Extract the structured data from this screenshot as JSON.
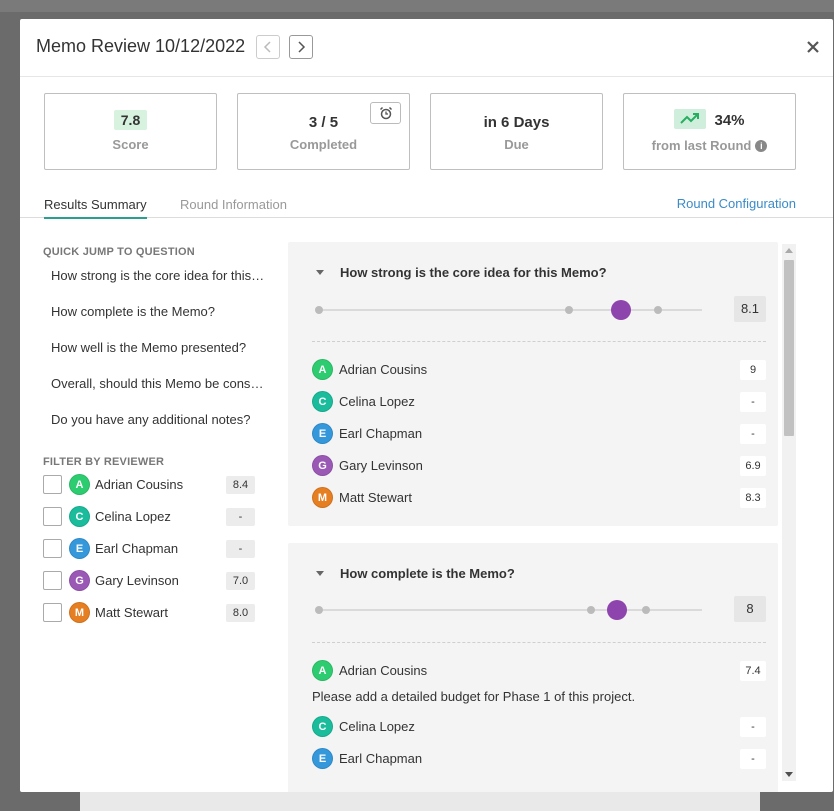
{
  "modal": {
    "title": "Memo Review 10/12/2022"
  },
  "stats": [
    {
      "value": "7.8",
      "label": "Score"
    },
    {
      "value": "3 / 5",
      "label": "Completed"
    },
    {
      "value": "in 6 Days",
      "label": "Due"
    },
    {
      "value": "34%",
      "label": "from last Round"
    }
  ],
  "tabs": {
    "results": "Results Summary",
    "round_info": "Round Information",
    "config": "Round Configuration"
  },
  "sidebar": {
    "jump_title": "QUICK JUMP TO QUESTION",
    "jump_items": [
      "How strong is the core idea for this Memo?",
      "How complete is the Memo?",
      "How well is the Memo presented?",
      "Overall, should this Memo be considered?",
      "Do you have any additional notes?"
    ],
    "filter_title": "FILTER BY REVIEWER",
    "reviewers": [
      {
        "initial": "A",
        "name": "Adrian Cousins",
        "score": "8.4"
      },
      {
        "initial": "C",
        "name": "Celina Lopez",
        "score": "-"
      },
      {
        "initial": "E",
        "name": "Earl Chapman",
        "score": "-"
      },
      {
        "initial": "G",
        "name": "Gary Levinson",
        "score": "7.0"
      },
      {
        "initial": "M",
        "name": "Matt Stewart",
        "score": "8.0"
      }
    ]
  },
  "questions": [
    {
      "text": "How strong is the core idea for this Memo?",
      "average": "8.1",
      "slider_value": 0.81,
      "responses": [
        {
          "initial": "A",
          "name": "Adrian Cousins",
          "score": "9"
        },
        {
          "initial": "C",
          "name": "Celina Lopez",
          "score": "-"
        },
        {
          "initial": "E",
          "name": "Earl Chapman",
          "score": "-"
        },
        {
          "initial": "G",
          "name": "Gary Levinson",
          "score": "6.9"
        },
        {
          "initial": "M",
          "name": "Matt Stewart",
          "score": "8.3"
        }
      ]
    },
    {
      "text": "How complete is the Memo?",
      "average": "8",
      "slider_value": 0.8,
      "responses": [
        {
          "initial": "A",
          "name": "Adrian Cousins",
          "score": "7.4",
          "note": "Please add a detailed budget for Phase 1 of this project."
        },
        {
          "initial": "C",
          "name": "Celina Lopez",
          "score": "-"
        },
        {
          "initial": "E",
          "name": "Earl Chapman",
          "score": "-"
        }
      ]
    }
  ],
  "colors": {
    "A": "#2ecc71",
    "C": "#1abc9c",
    "E": "#3498db",
    "G": "#9b59b6",
    "M": "#e67e22",
    "accent": "#2a9f8f",
    "link": "#3a8bc8",
    "knob": "#8e44ad"
  }
}
